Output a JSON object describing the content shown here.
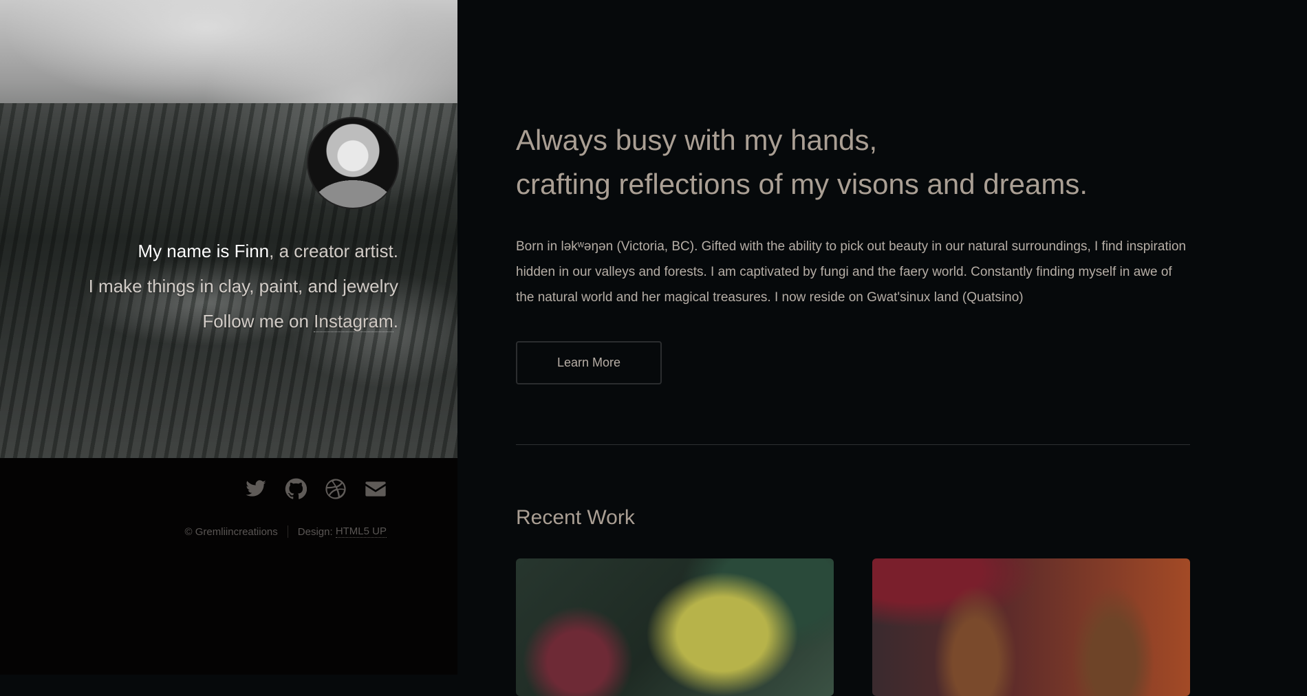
{
  "sidebar": {
    "intro": {
      "name": "My name is Finn",
      "tagline": ", a creator artist.",
      "line2": "I make things in clay, paint, and jewelry",
      "follow_prefix": "Follow me on ",
      "follow_link": "Instagram",
      "follow_suffix": "."
    },
    "socials": [
      {
        "icon": "twitter-icon"
      },
      {
        "icon": "github-icon"
      },
      {
        "icon": "dribbble-icon"
      },
      {
        "icon": "envelope-icon"
      }
    ],
    "footer": {
      "copyright": "© Gremliincreatiions",
      "design_label": "Design: ",
      "design_link": "HTML5 UP"
    }
  },
  "main": {
    "headline_line1": "Always busy with my hands,",
    "headline_line2": "crafting reflections of my visons and dreams.",
    "bio": "Born in ləkʷəŋən (Victoria, BC). Gifted with the ability to pick out beauty in our natural surroundings, I find inspiration hidden in our valleys and forests. I am captivated by fungi and the faery world. Constantly finding myself in awe of the natural world and her magical treasures. I now reside on Gwat'sinux land (Quatsino)",
    "learn_more": "Learn More",
    "recent_work_title": "Recent Work"
  },
  "colors": {
    "background": "#06090b",
    "sidebar_bg": "#040303",
    "heading": "#aa9f94",
    "body_text": "#b6aea6"
  }
}
